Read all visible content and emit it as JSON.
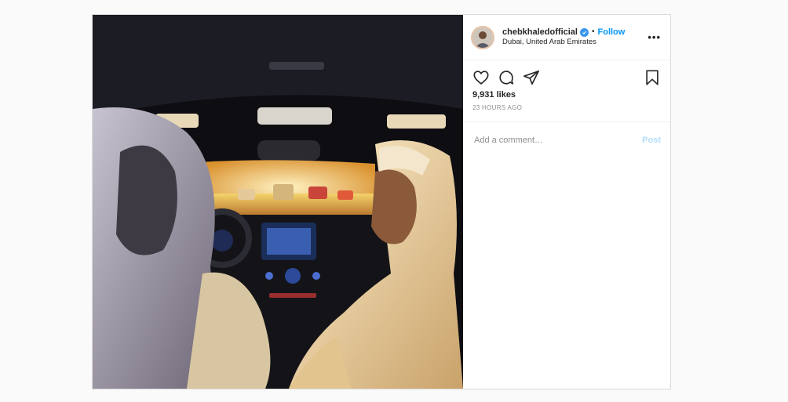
{
  "post": {
    "username": "chebkhaledofficial",
    "separator": "•",
    "follow_label": "Follow",
    "location": "Dubai, United Arab Emirates",
    "more_label": "•••",
    "likes": "9,931 likes",
    "timestamp": "23 HOURS AGO",
    "comment_placeholder": "Add a comment…",
    "post_label": "Post"
  },
  "icons": {
    "like": "heart-icon",
    "comment": "comment-icon",
    "share": "paper-plane-icon",
    "save": "bookmark-icon",
    "verified": "verified-badge-icon"
  },
  "colors": {
    "accent": "#0095f6",
    "verified": "#3897f0",
    "post_disabled": "#b2dffc",
    "text": "#262626",
    "muted": "#8e8e8e"
  }
}
